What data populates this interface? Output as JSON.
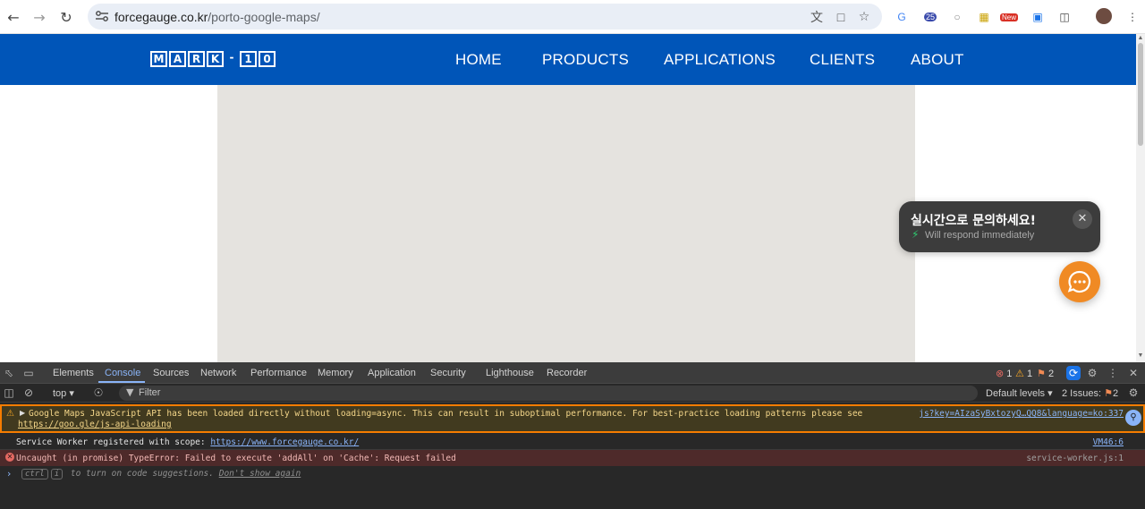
{
  "browser": {
    "url_domain": "forcegauge.co.kr",
    "url_path": "/porto-google-maps/",
    "extensions": {
      "badge_25": "25",
      "badge_new": "New"
    }
  },
  "site": {
    "logo_letters": [
      "M",
      "A",
      "R",
      "K",
      "-",
      "1",
      "0"
    ],
    "menu": [
      "HOME",
      "PRODUCTS",
      "APPLICATIONS",
      "CLIENTS",
      "ABOUT"
    ]
  },
  "chat": {
    "title": "실시간으로 문의하세요!",
    "subtitle": "Will respond immediately"
  },
  "devtools": {
    "tabs": [
      "Elements",
      "Console",
      "Sources",
      "Network",
      "Performance",
      "Memory",
      "Application",
      "Security",
      "Lighthouse",
      "Recorder"
    ],
    "active_tab": "Console",
    "counts": {
      "errors": "1",
      "warnings": "1",
      "issues": "2"
    },
    "context": "top",
    "filter_placeholder": "Filter",
    "levels": "Default levels",
    "issues_label": "2 Issues:",
    "issues_count": "2",
    "messages": {
      "warn_text": "Google Maps JavaScript API has been loaded directly without loading=async. This can result in suboptimal performance. For best-practice loading patterns please see",
      "warn_link": "https://goo.gle/js-api-loading",
      "warn_source": "js?key=AIzaSyBxtozyQ…QQ8&language=ko:337",
      "info_text": "Service Worker registered with scope: ",
      "info_link": "https://www.forcegauge.co.kr/",
      "info_source": "VM46:6",
      "error_text": "Uncaught (in promise) TypeError: Failed to execute 'addAll' on 'Cache': Request failed",
      "error_source": "service-worker.js:1"
    },
    "hint": {
      "key1": "ctrl",
      "key2": "i",
      "text": "to turn on code suggestions.",
      "dismiss": "Don't show again"
    }
  }
}
